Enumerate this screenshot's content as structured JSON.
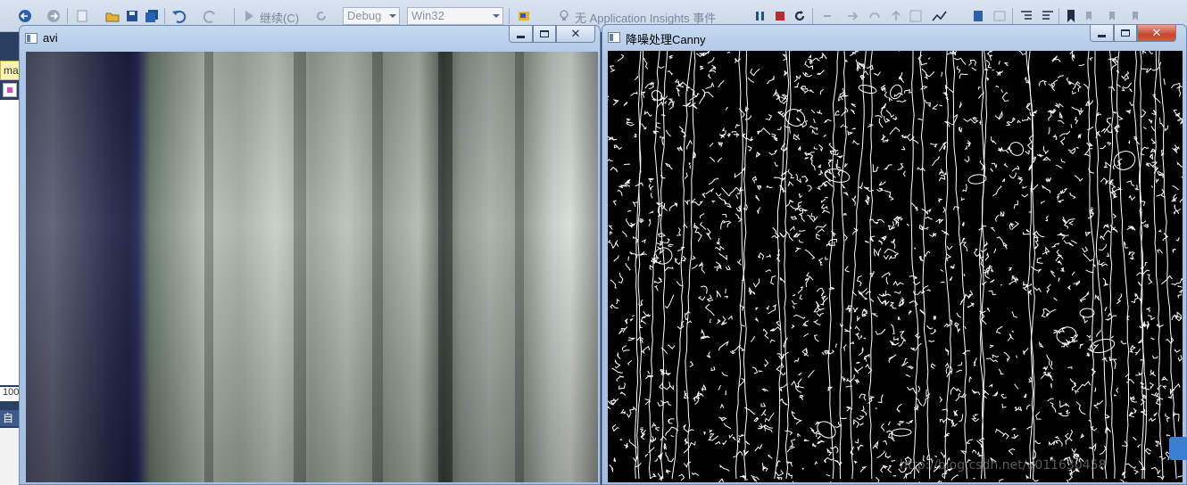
{
  "ide": {
    "toolbar": {
      "continue_label": "继续(C)",
      "config_value": "Debug",
      "platform_value": "Win32",
      "insights_label": "无 Application Insights 事件"
    },
    "left_tab_label": "ma",
    "left_zoom_label": "100",
    "left_auto_label": "自"
  },
  "windows": {
    "video": {
      "title": "avi"
    },
    "canny": {
      "title": "降噪处理Canny"
    }
  },
  "colors": {
    "toolbar_bg": "#cbd7e8",
    "window_frame": "#a6bfe0",
    "close_active": "#c7452f",
    "canny_bg": "#000000",
    "canny_edge": "#ffffff"
  },
  "watermark_text": "http://blog.csdn.net/u011630458"
}
